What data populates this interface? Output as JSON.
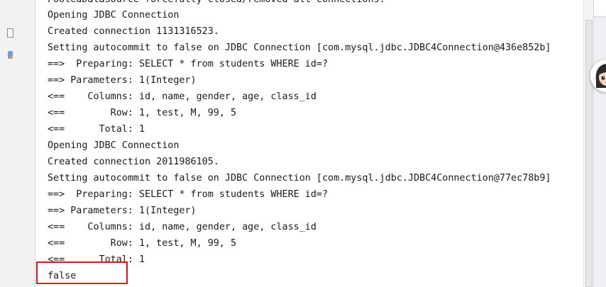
{
  "console": {
    "lines": [
      "PooledDataSource forcefully closed/removed all connections.",
      "Opening JDBC Connection",
      "Created connection 1131316523.",
      "Setting autocommit to false on JDBC Connection [com.mysql.jdbc.JDBC4Connection@436e852b]",
      "==>  Preparing: SELECT * from students WHERE id=?",
      "==> Parameters: 1(Integer)",
      "<==    Columns: id, name, gender, age, class_id",
      "<==        Row: 1, test, M, 99, 5",
      "<==      Total: 1",
      "Opening JDBC Connection",
      "Created connection 2011986105.",
      "Setting autocommit to false on JDBC Connection [com.mysql.jdbc.JDBC4Connection@77ec78b9]",
      "==>  Preparing: SELECT * from students WHERE id=?",
      "==> Parameters: 1(Integer)",
      "<==    Columns: id, name, gender, age, class_id",
      "<==        Row: 1, test, M, 99, 5",
      "<==      Total: 1",
      "false"
    ]
  },
  "colors": {
    "highlight_border": "#e8141b",
    "console_text": "#1a1a1a",
    "console_background": "#ffffff"
  },
  "icons": [
    "file-icon",
    "service-icon",
    "avatar-icon"
  ]
}
